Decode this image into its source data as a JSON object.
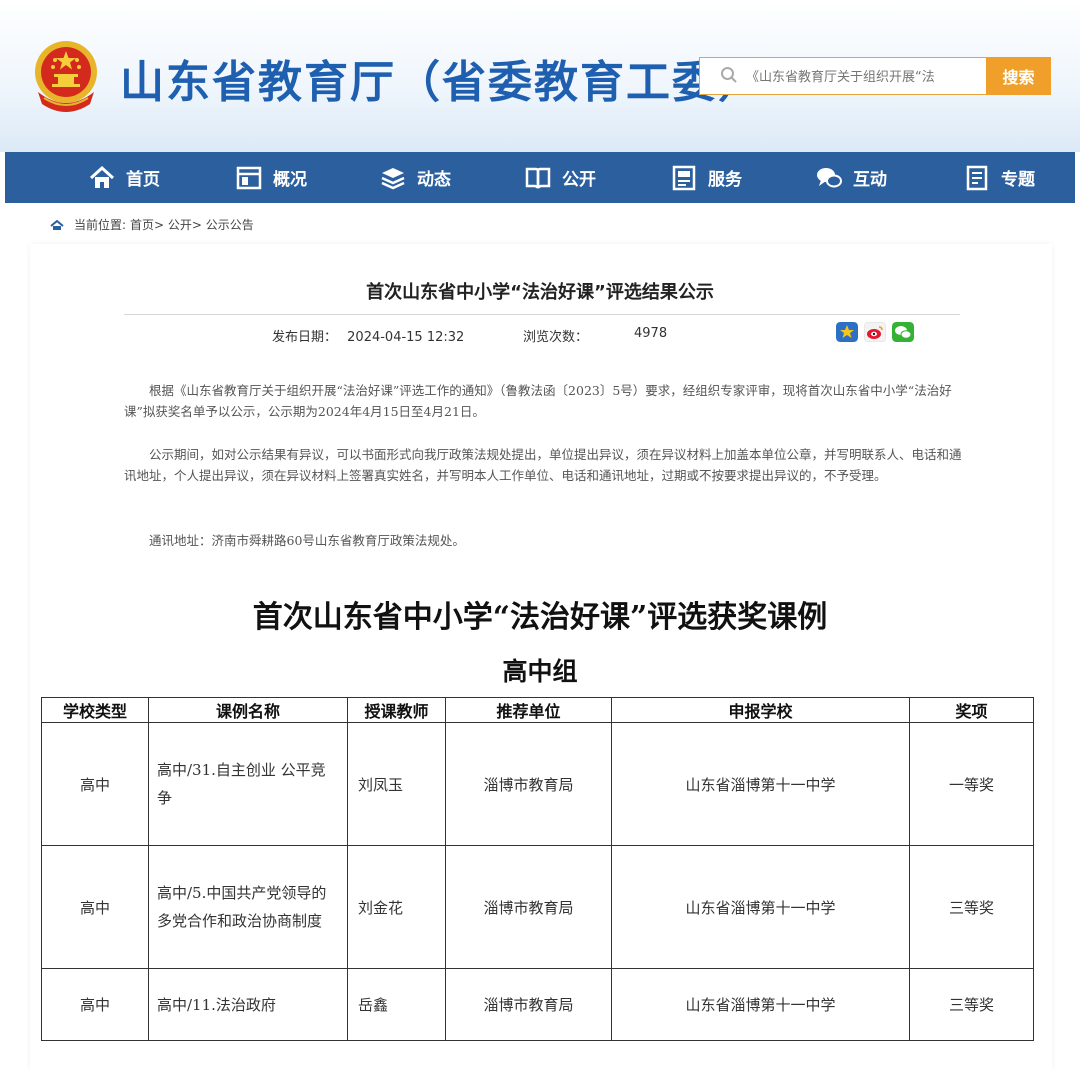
{
  "header": {
    "site_title": "山东省教育厅（省委教育工委）",
    "emblem_icon": "national-emblem-icon",
    "search_placeholder": "《山东省教育厅关于组织开展“法",
    "search_button": "搜索",
    "colors": {
      "title": "#1f5fb0",
      "search_button": "#f0a02a",
      "nav": "#2b5f9e"
    }
  },
  "nav": {
    "items": [
      {
        "label": "首页",
        "icon": "home-icon"
      },
      {
        "label": "概况",
        "icon": "window-icon"
      },
      {
        "label": "动态",
        "icon": "stack-icon"
      },
      {
        "label": "公开",
        "icon": "book-icon"
      },
      {
        "label": "服务",
        "icon": "service-icon"
      },
      {
        "label": "互动",
        "icon": "chat-icon"
      },
      {
        "label": "专题",
        "icon": "document-icon"
      }
    ]
  },
  "breadcrumb": {
    "prefix": "当前位置:",
    "path": "首页> 公开> 公示公告"
  },
  "article": {
    "title": "首次山东省中小学“法治好课”评选结果公示",
    "date_label": "发布日期：",
    "date_value": "2024-04-15 12:32",
    "views_label": "浏览次数：",
    "views_value": "4978",
    "share_icons": [
      "favorite-icon",
      "weibo-icon",
      "wechat-icon"
    ],
    "paragraphs": [
      "根据《山东省教育厅关于组织开展“法治好课”评选工作的通知》（鲁教法函〔2023〕5号）要求，经组织专家评审，现将首次山东省中小学“法治好课”拟获奖名单予以公示，公示期为2024年4月15日至4月21日。",
      "公示期间，如对公示结果有异议，可以书面形式向我厅政策法规处提出，单位提出异议，须在异议材料上加盖本单位公章，并写明联系人、电话和通讯地址，个人提出异议，须在异议材料上签署真实姓名，并写明本人工作单位、电话和通讯地址，过期或不按要求提出异议的，不予受理。",
      "通讯地址：济南市舜耕路60号山东省教育厅政策法规处。"
    ]
  },
  "awards": {
    "title": "首次山东省中小学“法治好课”评选获奖课例",
    "group": "高中组",
    "headers": [
      "学校类型",
      "课例名称",
      "授课教师",
      "推荐单位",
      "申报学校",
      "奖项"
    ],
    "rows": [
      {
        "type": "高中",
        "name": "高中/31.自主创业 公平竞争",
        "teacher": "刘凤玉",
        "unit": "淄博市教育局",
        "school": "山东省淄博第十一中学",
        "award": "一等奖"
      },
      {
        "type": "高中",
        "name": "高中/5.中国共产党领导的多党合作和政治协商制度",
        "teacher": "刘金花",
        "unit": "淄博市教育局",
        "school": "山东省淄博第十一中学",
        "award": "三等奖"
      },
      {
        "type": "高中",
        "name": "高中/11.法治政府",
        "teacher": "岳鑫",
        "unit": "淄博市教育局",
        "school": "山东省淄博第十一中学",
        "award": "三等奖"
      }
    ]
  }
}
